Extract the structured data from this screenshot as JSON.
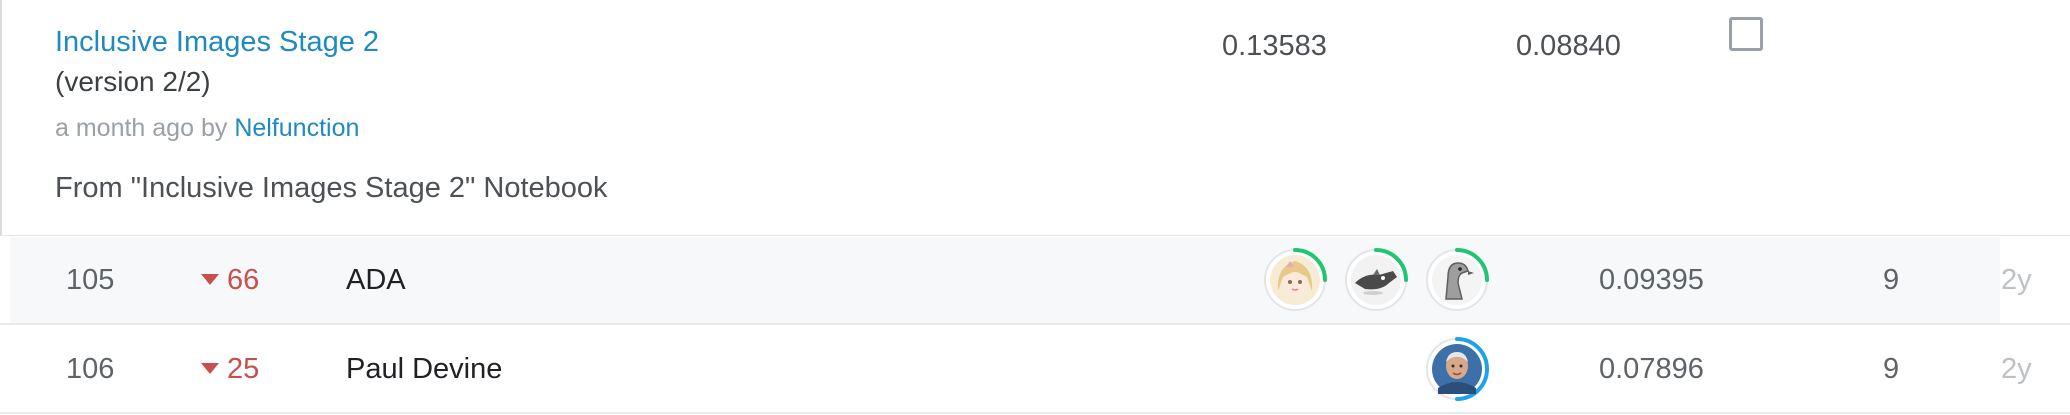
{
  "submission": {
    "title": "Inclusive Images Stage 2",
    "version": "(version 2/2)",
    "time_ago": "a month ago",
    "by_text": "by",
    "author": "Nelfunction",
    "source": "From \"Inclusive Images Stage 2\" Notebook",
    "private_score": "0.13583",
    "public_score": "0.08840",
    "selected": false
  },
  "leaderboard": {
    "rows": [
      {
        "rank": "105",
        "delta": "66",
        "delta_direction": "down",
        "team": "ADA",
        "member_avatars": [
          "cartoon-girl-avatar",
          "animal-avatar",
          "bird-avatar"
        ],
        "score": "0.09395",
        "entries": "9",
        "last": "2y"
      },
      {
        "rank": "106",
        "delta": "25",
        "delta_direction": "down",
        "team": "Paul Devine",
        "member_avatars": [
          "person-photo-avatar"
        ],
        "score": "0.07896",
        "entries": "9",
        "last": "2y"
      }
    ]
  },
  "colors": {
    "link": "#1f8ac0",
    "decline": "#c5504c",
    "tier_green": "#20c472",
    "tier_blue": "#1ea4e6"
  }
}
